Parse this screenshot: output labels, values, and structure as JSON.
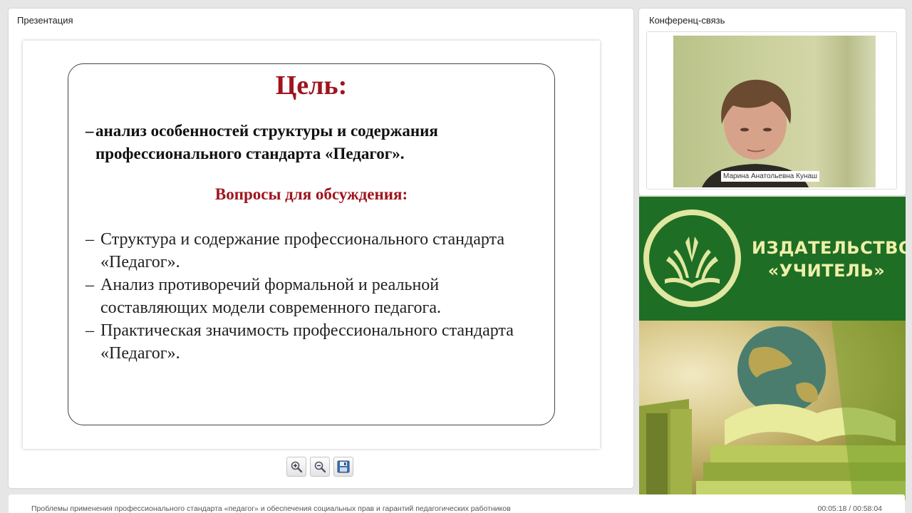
{
  "presentation": {
    "panel_title": "Презентация",
    "slide": {
      "title": "Цель:",
      "goal_dash": "–",
      "goal_text": "анализ особенностей структуры и содержания профессионального стандарта «Педагог».",
      "questions_heading": "Вопросы для обсуждения:",
      "items": [
        {
          "dash": "–",
          "text": "Структура и содержание профессионального стандарта «Педагог»."
        },
        {
          "dash": "–",
          "text": "Анализ противоречий формальной и реальной составляющих модели современного педагога."
        },
        {
          "dash": "–",
          "text": "Практическая значимость профессионального стандарта «Педагог»."
        }
      ]
    },
    "toolbar": {
      "zoom_in_icon": "magnifier-plus-icon",
      "zoom_out_icon": "magnifier-minus-icon",
      "save_icon": "floppy-disk-icon"
    }
  },
  "conference": {
    "panel_title": "Конференц-связь",
    "speaker_name": "Марина Анатольевна Кунаш"
  },
  "banner": {
    "brand_line1": "ИЗДАТЕЛЬСТВО",
    "brand_line2": "«УЧИТЕЛЬ»",
    "colors": {
      "green": "#1f6e25",
      "cream": "#e0e7a0"
    }
  },
  "footer": {
    "webinar_title": "Проблемы применения профессионального стандарта «педагог» и обеспечения социальных прав и гарантий педагогических работников",
    "timecode": "00:05:18 / 00:58:04"
  },
  "colors": {
    "accent_red": "#a0141e"
  }
}
